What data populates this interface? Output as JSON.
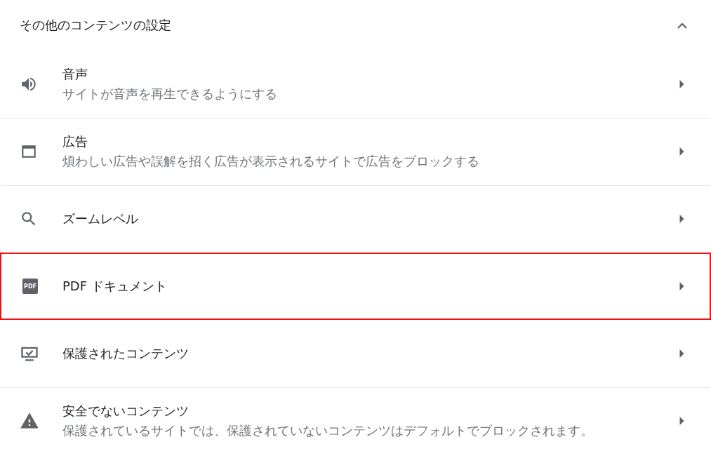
{
  "section": {
    "title": "その他のコンテンツの設定",
    "expanded": true
  },
  "items": [
    {
      "kind": "sound",
      "title": "音声",
      "subtitle": "サイトが音声を再生できるようにする",
      "highlighted": false
    },
    {
      "kind": "ads",
      "title": "広告",
      "subtitle": "煩わしい広告や誤解を招く広告が表示されるサイトで広告をブロックする",
      "highlighted": false
    },
    {
      "kind": "zoom",
      "title": "ズームレベル",
      "highlighted": false
    },
    {
      "kind": "pdf",
      "title": "PDF ドキュメント",
      "icon_text": "PDF",
      "highlighted": true
    },
    {
      "kind": "protected",
      "title": "保護されたコンテンツ",
      "highlighted": false
    },
    {
      "kind": "warning",
      "title": "安全でないコンテンツ",
      "subtitle": "保護されているサイトでは、保護されていないコンテンツはデフォルトでブロックされます。",
      "highlighted": false
    }
  ]
}
